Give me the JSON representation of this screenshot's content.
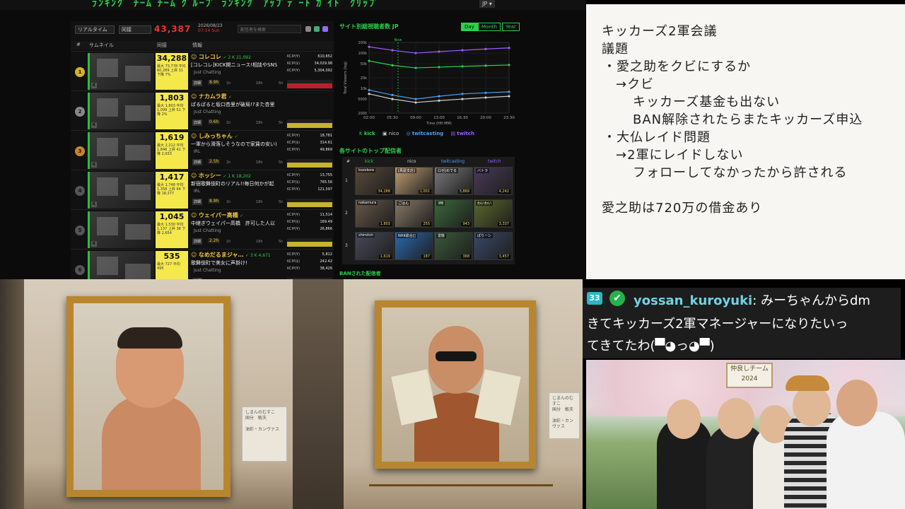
{
  "topbar": {
    "nav_text": "ﾗﾝｷﾝｸﾞ  ﾁｰﾑ  ﾁｰﾑ  ｸﾞﾙｰﾌﾟ  ﾗﾝｷﾝｸﾞ  ｱｯﾌﾟﾃﾞｰﾄ  ｶﾞｲﾄﾞ  ｸﾘｯﾌﾟ",
    "lang": "JP ▾"
  },
  "dashboard": {
    "mode_select": "リアルタイム",
    "concurrent_select": "同接",
    "total_viewers": "43,387",
    "date": "2026/08/23",
    "time": "07:14 Sun",
    "search_placeholder": "配信者を検索",
    "columns": {
      "rank": "#",
      "thumb": "サムネイル",
      "viewers": "同接",
      "info": "情報"
    },
    "rows": [
      {
        "rank": "1",
        "viewers": "34,288",
        "stats": "最大 73,778 平均 60,289 上昇 31 下降 7%",
        "name": "コレコレ",
        "badges": "✓ 2  K 21,092",
        "title": "[コレコレ]KICK開ニュース!相談やSNS",
        "category": "Just Chatting",
        "dur": "8.9h",
        "m1": "KCIP(¥)",
        "v1": "610,652",
        "m2": "KCIP($)",
        "v2": "34,029.98",
        "m3": "KCIP(¥)",
        "v3": "5,304,092"
      },
      {
        "rank": "2",
        "viewers": "1,803",
        "stats": "最大 1,803 平均 1,099 上昇 51 下降 2%",
        "name": "ナカムラ君",
        "badges": "✓",
        "title": "ぱるぱると坂口杏里が破局!?また杏里",
        "category": "Just Chatting",
        "dur": "0.6h",
        "m1": "",
        "v1": "",
        "m2": "",
        "v2": "",
        "m3": "",
        "v3": ""
      },
      {
        "rank": "3",
        "viewers": "1,619",
        "stats": "最大 2,212 平均 1,846 上昇 41 下降 2,933",
        "name": "しみっちゃん",
        "badges": "✓",
        "title": "一軍から滑落しそうなので家賃の安い)",
        "category": "IRL",
        "dur": "2.5h",
        "m1": "KCIP(¥)",
        "v1": "18,781",
        "m2": "KCIP($)",
        "v2": "314.61",
        "m3": "KCIP(¥)",
        "v3": "49,869"
      },
      {
        "rank": "4",
        "viewers": "1,417",
        "stats": "最大 1,748 平均 1,358 上昇 64 下降 18,377",
        "name": "ホッシー",
        "badges": "✓ 1  K 18,202",
        "title": "新宿歌舞伎町のリアル!!毎日何かが起",
        "category": "IRL",
        "dur": "8.9h",
        "m1": "KCIP(¥)",
        "v1": "13,755",
        "m2": "KCIP($)",
        "v2": "765.56",
        "m3": "KCIP(¥)",
        "v3": "121,597"
      },
      {
        "rank": "5",
        "viewers": "1,045",
        "stats": "最大 1,530 平均 1,137 上昇 38 下降 2,654",
        "name": "ウェイパー高橋",
        "badges": "✓",
        "title": "中継ぎウェイパー高橋　許可した人以",
        "category": "Just Chatting",
        "dur": "2.2h",
        "m1": "KCIP(¥)",
        "v1": "11,514",
        "m2": "KCIP($)",
        "v2": "169.49",
        "m3": "KCIP(¥)",
        "v3": "26,866"
      },
      {
        "rank": "6",
        "viewers": "535",
        "stats": "最大 727 平均 495",
        "name": "なめだるまジャ…",
        "badges": "✓ 3  K 4,671",
        "title": "歌舞伎町で美女に声掛け!",
        "category": "Just Chatting",
        "dur": "",
        "m1": "KCIP(¥)",
        "v1": "5,812",
        "m2": "KCIP($)",
        "v2": "242.42",
        "m3": "KCIP(¥)",
        "v3": "38,426"
      }
    ],
    "ticks": {
      "a": "1h",
      "b": "18h",
      "c": "5h"
    },
    "detail_btn": "詳細",
    "chart_title": "サイト別総視聴者数 JP",
    "range_buttons": [
      "Day",
      "Month",
      "Year"
    ],
    "legend": [
      "kick",
      "nico",
      "twitcasting",
      "twitch"
    ],
    "top_title": "各サイトのトップ配信者",
    "top_headers": [
      "#",
      "kick",
      "nico",
      "twitcasting",
      "twitch"
    ],
    "top_rows": [
      {
        "no": "1",
        "cells": [
          {
            "n": "kozokore",
            "v": "34,288"
          },
          {
            "n": "[馬屋支店]",
            "v": "1,001"
          },
          {
            "n": "ロゼ[めでる",
            "v": "3,869"
          },
          {
            "n": "バトラ",
            "v": "4,242"
          }
        ]
      },
      {
        "no": "2",
        "cells": [
          {
            "n": "nakamura",
            "v": "1,803"
          },
          {
            "n": "ごはん",
            "v": "255"
          },
          {
            "n": "3時",
            "v": "943"
          },
          {
            "n": "わいわい",
            "v": "3,337"
          }
        ]
      },
      {
        "no": "3",
        "cells": [
          {
            "n": "shimitch",
            "v": "1,619"
          },
          {
            "n": "NHK総合[]",
            "v": "187"
          },
          {
            "n": "雷獣",
            "v": "368"
          },
          {
            "n": "ぽりーシ",
            "v": "3,457"
          }
        ]
      }
    ],
    "ban_title": "BANされた配信者"
  },
  "chart_data": {
    "type": "line",
    "title": "サイト別総視聴者数 JP",
    "xlabel": "Time (HH:MM)",
    "ylabel": "Total Viewers (log)",
    "x": [
      "02:00",
      "05:30",
      "09:00",
      "13:00",
      "16:30",
      "20:00",
      "23:30"
    ],
    "yticks": [
      "200k",
      "100k",
      "50k",
      "20k",
      "10k",
      "5000",
      "2000"
    ],
    "now_label": "Now",
    "series": [
      {
        "name": "kick",
        "color": "#2ad14a",
        "values": [
          60000,
          45000,
          38000,
          40000,
          42000,
          44000,
          46000
        ]
      },
      {
        "name": "nico",
        "color": "#cccccc",
        "values": [
          7000,
          5000,
          4000,
          4500,
          5000,
          5500,
          6000
        ]
      },
      {
        "name": "twitcasting",
        "color": "#4aa0f0",
        "values": [
          9000,
          6500,
          5000,
          6000,
          7000,
          7500,
          8000
        ]
      },
      {
        "name": "twitch",
        "color": "#9b5cff",
        "values": [
          150000,
          120000,
          100000,
          110000,
          120000,
          130000,
          140000
        ]
      }
    ]
  },
  "agenda": {
    "lines": [
      "キッカーズ2軍会議",
      "議題",
      "・愛之助をクビにするか",
      "→クビ",
      "キッカーズ基金も出ない",
      "BAN解除されたらまたキッカーズ申込",
      "・大仏レイド問題",
      "→2軍にレイドしない",
      "フォローしてなかったから許される",
      "愛之助は720万の借金あり"
    ]
  },
  "gallery": {
    "plaque1": [
      "しまんのむすこ",
      "国分　敏夫",
      "",
      "油彩・カンヴァス"
    ],
    "plaque2": [
      "じまんのむすこ",
      "国分　敏夫",
      "",
      "油彩・カンヴァス"
    ]
  },
  "chat": {
    "badge": "33",
    "username": "yossan_kuroyuki",
    "line1": ": みーちゃんからdm",
    "line2": "きてキッカーズ2軍マネージャーになりたいっ",
    "line3": "てきてたわ(▀◕っ◕▀)"
  },
  "photo": {
    "sign1": "仲良しチーム",
    "sign2": "2024"
  }
}
